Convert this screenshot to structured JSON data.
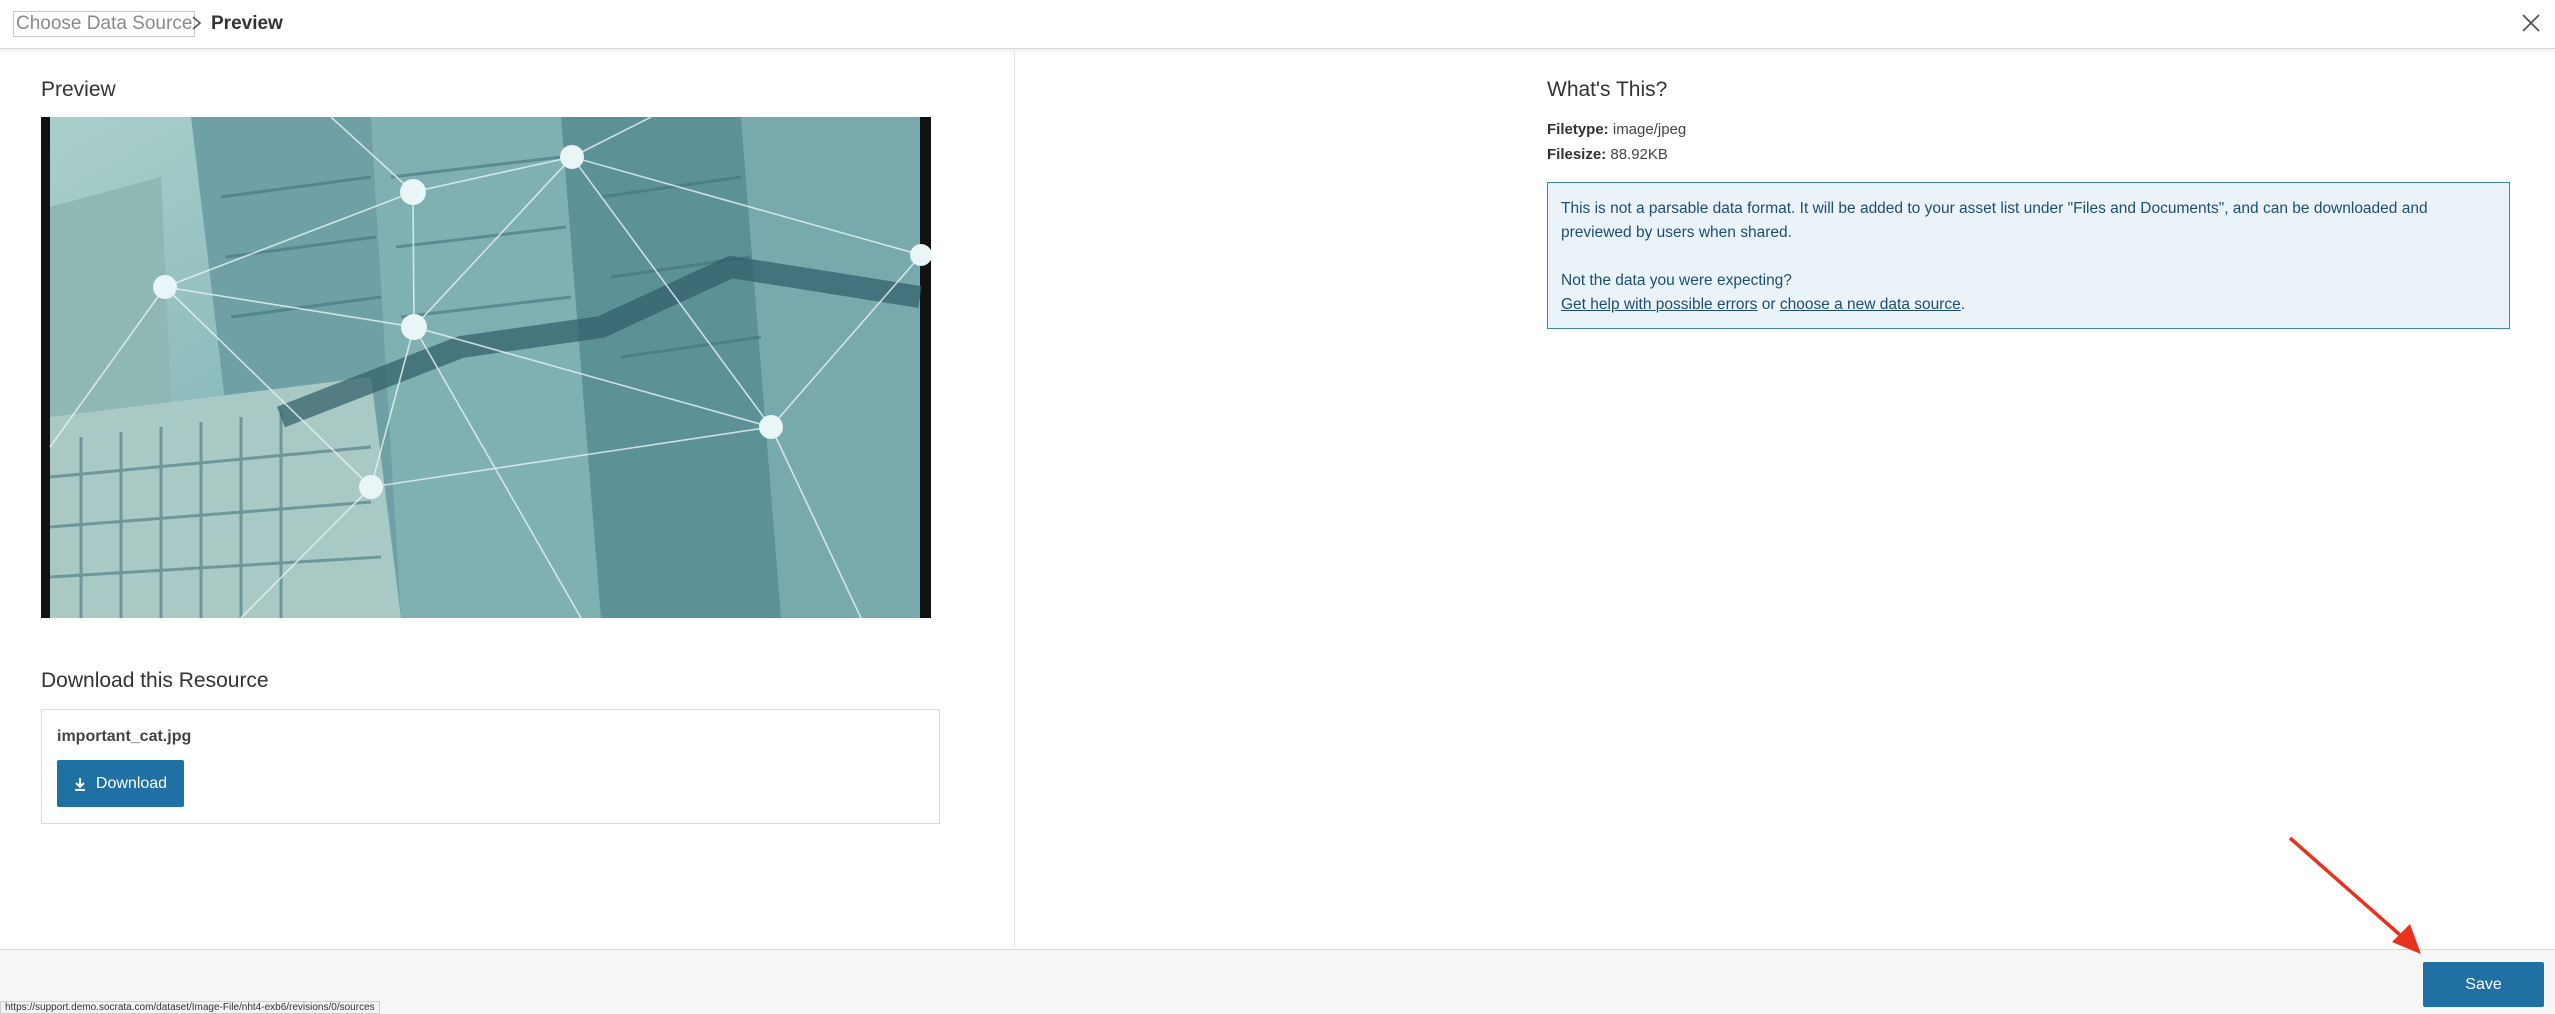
{
  "header": {
    "breadcrumb_link": "Choose Data Source",
    "breadcrumb_current": "Preview",
    "close_icon": "close-icon"
  },
  "left": {
    "preview_title": "Preview",
    "download_title": "Download this Resource",
    "file_name": "important_cat.jpg",
    "download_label": "Download",
    "download_icon": "download-icon"
  },
  "right": {
    "title": "What's This?",
    "filetype_label": "Filetype:",
    "filetype_value": "image/jpeg",
    "filesize_label": "Filesize:",
    "filesize_value": "88.92KB",
    "info_text": "This is not a parsable data format. It will be added to your asset list under \"Files and Documents\", and can be downloaded and previewed by users when shared.",
    "expecting_text": "Not the data you were expecting?",
    "help_link": "Get help with possible errors",
    "or_text": " or ",
    "new_source_link": " choose a new data source",
    "period": "."
  },
  "footer": {
    "status_url": "https://support.demo.socrata.com/dataset/Image-File/nht4-exb6/revisions/0/sources",
    "save_label": "Save"
  },
  "colors": {
    "primary": "#1f71a3",
    "info_bg": "#eaf3f8",
    "info_border": "#3b84b8",
    "annotation_arrow": "#e8321e"
  }
}
